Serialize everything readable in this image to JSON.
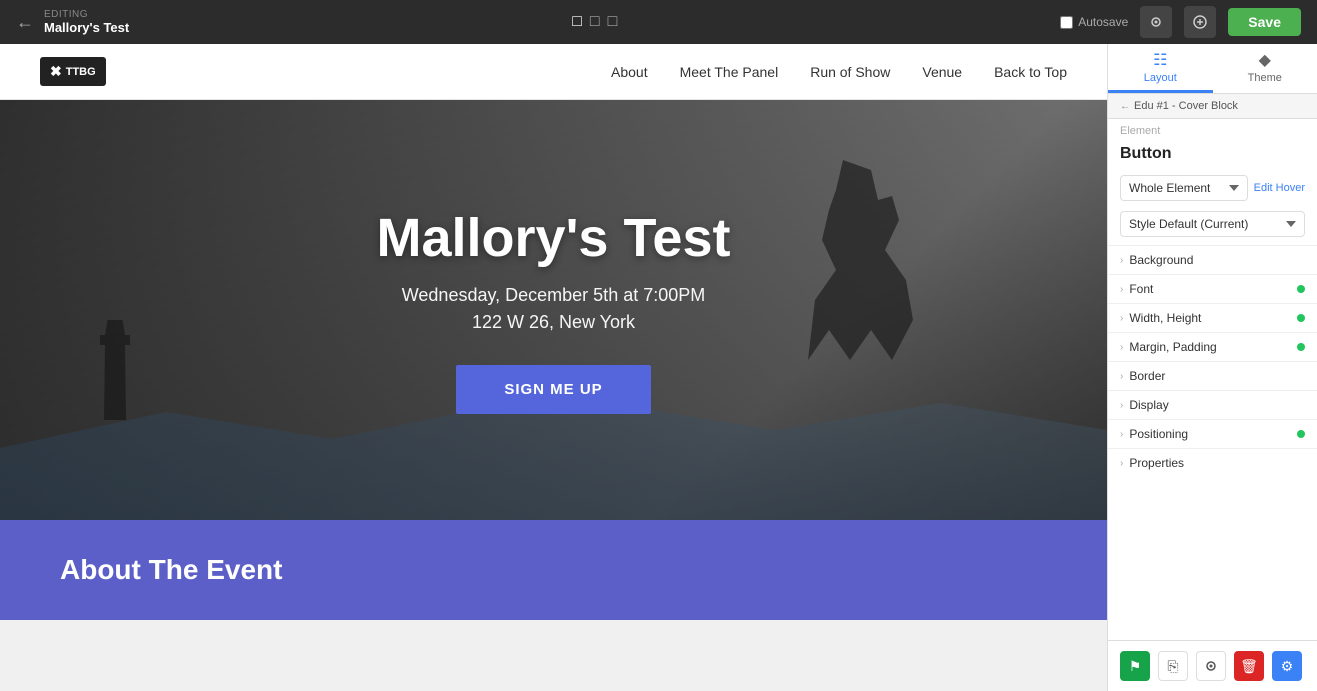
{
  "topbar": {
    "editing_label": "EDITING",
    "page_name": "Mallory's Test",
    "save_button": "Save",
    "autosave_label": "Autosave"
  },
  "nav": {
    "logo_text": "TTBG",
    "items": [
      {
        "label": "About"
      },
      {
        "label": "Meet The Panel"
      },
      {
        "label": "Run of Show"
      },
      {
        "label": "Venue"
      },
      {
        "label": "Back to Top"
      }
    ]
  },
  "hero": {
    "title": "Mallory's Test",
    "date": "Wednesday, December 5th at 7:00PM",
    "location": "122 W 26, New York",
    "cta_button": "SIGN ME UP"
  },
  "about_section": {
    "title": "About The Event"
  },
  "panel": {
    "layout_tab": "Layout",
    "theme_tab": "Theme",
    "breadcrumb": "Edu #1 - Cover Block",
    "element_label": "Element",
    "section_title": "Button",
    "whole_element_label": "Whole Element",
    "edit_hover_label": "Edit Hover",
    "style_default_label": "Style Default (Current)",
    "properties": [
      {
        "label": "Background",
        "has_dot": false
      },
      {
        "label": "Font",
        "has_dot": true
      },
      {
        "label": "Width, Height",
        "has_dot": true
      },
      {
        "label": "Margin, Padding",
        "has_dot": true
      },
      {
        "label": "Border",
        "has_dot": false
      },
      {
        "label": "Display",
        "has_dot": false
      },
      {
        "label": "Positioning",
        "has_dot": true
      },
      {
        "label": "Properties",
        "has_dot": false
      }
    ]
  }
}
